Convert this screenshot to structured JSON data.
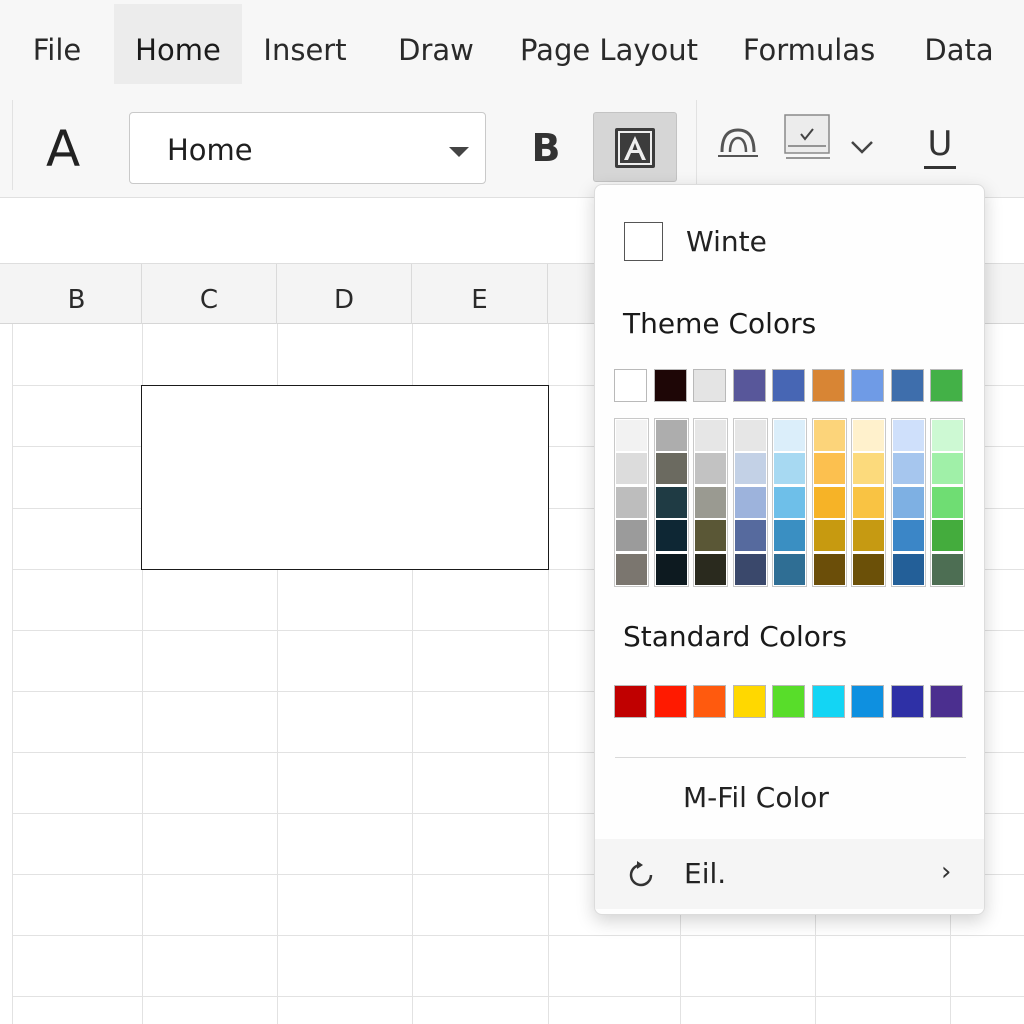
{
  "menubar": {
    "tabs": [
      {
        "label": "File"
      },
      {
        "label": "Home"
      },
      {
        "label": "Insert"
      },
      {
        "label": "Draw"
      },
      {
        "label": "Page Layout"
      },
      {
        "label": "Formulas"
      },
      {
        "label": "Data"
      }
    ],
    "active_tab": "Home"
  },
  "ribbon": {
    "font_glyph": "A",
    "style_select_value": "Home",
    "bold_label": "B",
    "underline_label": "U",
    "icons": [
      "font-icon",
      "fill-color-icon",
      "shape-icon",
      "checkbox-icon",
      "chevron-down-icon",
      "underline-icon"
    ]
  },
  "columns": [
    "B",
    "C",
    "D",
    "E"
  ],
  "color_menu": {
    "no_fill_label": "Winte",
    "theme_title": "Theme Colors",
    "theme_top": [
      "#ffffff",
      "#1e0606",
      "#e4e4e4",
      "#58579a",
      "#4766b4",
      "#d88534",
      "#6f9be6",
      "#3e6eac",
      "#43b147"
    ],
    "theme_shades": [
      [
        "#f2f2f2",
        "#dcdcdc",
        "#bdbdbd",
        "#9b9b9b",
        "#7b766f"
      ],
      [
        "#adadad",
        "#6b6a60",
        "#1f3b44",
        "#0e2734",
        "#0d1a20"
      ],
      [
        "#e6e6e6",
        "#c2c2c2",
        "#9a9a91",
        "#5a5736",
        "#2a2a1e"
      ],
      [
        "#e6e6e6",
        "#c3d1e6",
        "#9db3dc",
        "#566a9e",
        "#3a486b"
      ],
      [
        "#dbeefa",
        "#a7d9f2",
        "#6ebfe9",
        "#3a8fc2",
        "#2f6e94"
      ],
      [
        "#fcd47a",
        "#fcc04f",
        "#f6b327",
        "#c79a10",
        "#6b4e09"
      ],
      [
        "#fff1cc",
        "#fcda7c",
        "#f9c343",
        "#c69a12",
        "#6b5008"
      ],
      [
        "#cfe0fb",
        "#a6c6ee",
        "#7eb0e3",
        "#3b86c7",
        "#235f98"
      ],
      [
        "#cdf9d3",
        "#a0f0a8",
        "#6fdd73",
        "#44ac3d",
        "#4d6e53"
      ]
    ],
    "standard_title": "Standard Colors",
    "standard": [
      "#c00000",
      "#ff1a00",
      "#ff5a0e",
      "#ffd800",
      "#58dd2a",
      "#13d5f4",
      "#0e90e0",
      "#2e30a6",
      "#4b2f8f"
    ],
    "more_colors_label": "M-Fil Color",
    "eyedropper_label": "Eil."
  }
}
